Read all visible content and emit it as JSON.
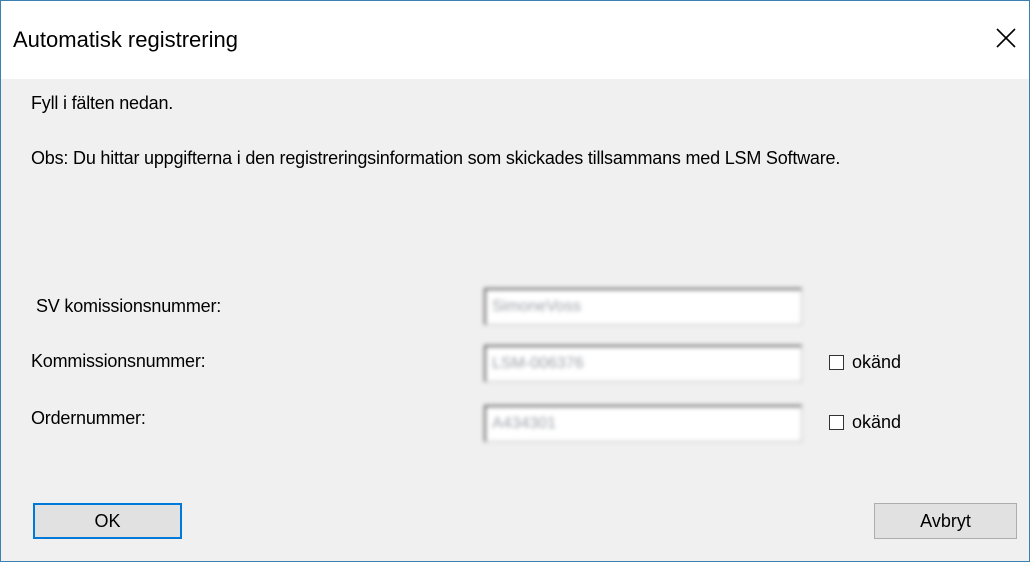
{
  "dialog": {
    "title": "Automatisk registrering",
    "close_icon": "close-icon"
  },
  "intro": {
    "line1": "Fyll i fälten nedan.",
    "line2": "Obs: Du hittar uppgifterna i den registreringsinformation som skickades tillsammans med LSM Software."
  },
  "form": {
    "sv_commission": {
      "label": "SV komissionsnummer:",
      "value": "SimoneVoss"
    },
    "commission": {
      "label": "Kommissionsnummer:",
      "value": "LSM-006376",
      "unknown_label": "okänd",
      "unknown_checked": false
    },
    "order": {
      "label": "Ordernummer:",
      "value": "A434301",
      "unknown_label": "okänd",
      "unknown_checked": false
    }
  },
  "buttons": {
    "ok": "OK",
    "cancel": "Avbryt"
  },
  "colors": {
    "window_border": "#3c7fb1",
    "dialog_bg": "#f0f0f0",
    "default_button_border": "#0078d7"
  }
}
